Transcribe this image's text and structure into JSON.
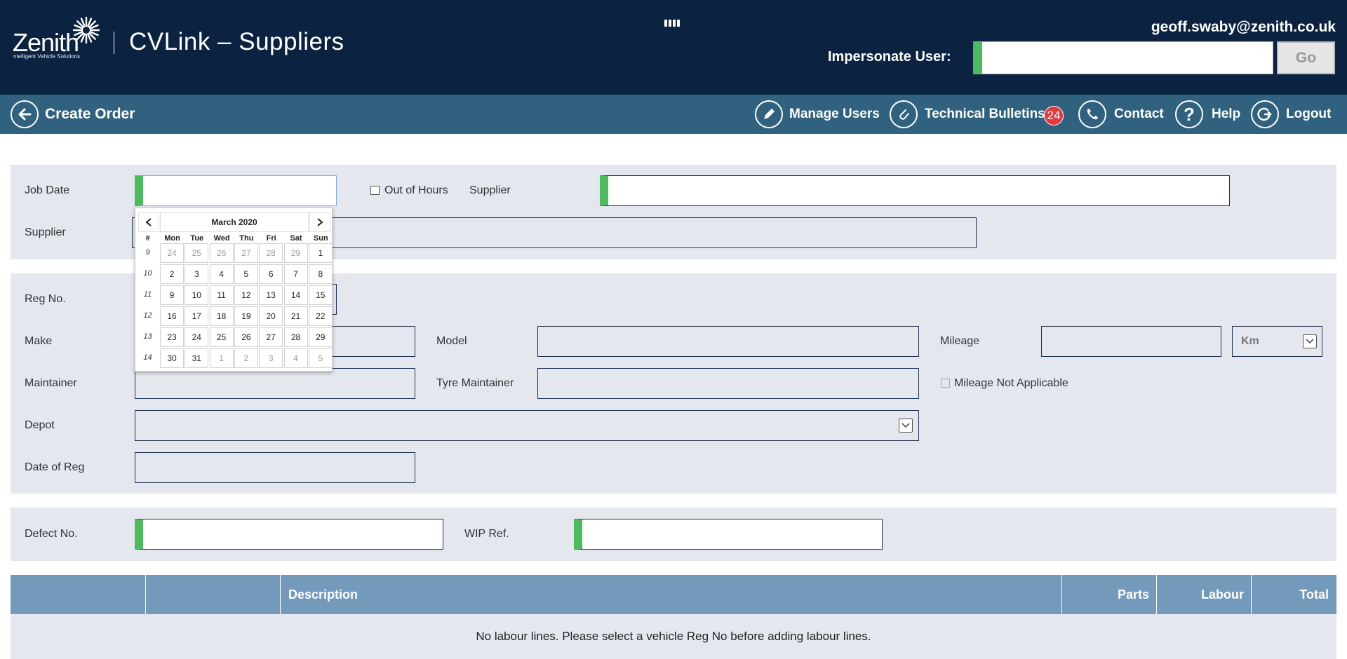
{
  "header": {
    "logo_word": "Zenith",
    "logo_tagline": "ntelligent Vehicle Solutions",
    "app_title": "CVLink – Suppliers",
    "user_email": "geoff.swaby@zenith.co.uk",
    "impersonate_label": "Impersonate User:",
    "impersonate_value": "",
    "go_label": "Go"
  },
  "nav": {
    "page_title": "Create Order",
    "items": [
      {
        "label": "Manage Users",
        "icon": "pencil-icon"
      },
      {
        "label": "Technical Bulletins",
        "icon": "paperclip-icon",
        "badge": "24"
      },
      {
        "label": "Contact",
        "icon": "phone-icon"
      },
      {
        "label": "Help",
        "icon": "question-icon"
      },
      {
        "label": "Logout",
        "icon": "logout-icon"
      }
    ]
  },
  "form": {
    "job_date_label": "Job Date",
    "out_of_hours_label": "Out of Hours",
    "supplier_label": "Supplier",
    "supplier_label_2": "Supplier",
    "reg_no_label": "Reg No.",
    "make_label": "Make",
    "model_label": "Model",
    "mileage_label": "Mileage",
    "mileage_unit": "Km",
    "maintainer_label": "Maintainer",
    "tyre_maintainer_label": "Tyre Maintainer",
    "mileage_na_label": "Mileage Not Applicable",
    "depot_label": "Depot",
    "date_of_reg_label": "Date of Reg",
    "defect_no_label": "Defect No.",
    "wip_ref_label": "WIP Ref."
  },
  "calendar": {
    "month_label": "March 2020",
    "week_header": "#",
    "day_headers": [
      "Mon",
      "Tue",
      "Wed",
      "Thu",
      "Fri",
      "Sat",
      "Sun"
    ],
    "weeks": [
      {
        "wk": "9",
        "days": [
          "24",
          "25",
          "26",
          "27",
          "28",
          "29",
          "1"
        ],
        "out": [
          true,
          true,
          true,
          true,
          true,
          true,
          false
        ]
      },
      {
        "wk": "10",
        "days": [
          "2",
          "3",
          "4",
          "5",
          "6",
          "7",
          "8"
        ],
        "out": [
          false,
          false,
          false,
          false,
          false,
          false,
          false
        ]
      },
      {
        "wk": "11",
        "days": [
          "9",
          "10",
          "11",
          "12",
          "13",
          "14",
          "15"
        ],
        "out": [
          false,
          false,
          false,
          false,
          false,
          false,
          false
        ]
      },
      {
        "wk": "12",
        "days": [
          "16",
          "17",
          "18",
          "19",
          "20",
          "21",
          "22"
        ],
        "out": [
          false,
          false,
          false,
          false,
          false,
          false,
          false
        ]
      },
      {
        "wk": "13",
        "days": [
          "23",
          "24",
          "25",
          "26",
          "27",
          "28",
          "29"
        ],
        "out": [
          false,
          false,
          false,
          false,
          false,
          false,
          false
        ]
      },
      {
        "wk": "14",
        "days": [
          "30",
          "31",
          "1",
          "2",
          "3",
          "4",
          "5"
        ],
        "out": [
          false,
          false,
          true,
          true,
          true,
          true,
          true
        ]
      }
    ]
  },
  "grid": {
    "columns": [
      "",
      "",
      "Description",
      "Parts",
      "Labour",
      "Total"
    ],
    "empty_message": "No labour lines. Please select a vehicle Reg No before adding labour lines."
  },
  "colors": {
    "header_bg": "#0b2240",
    "nav_bg": "#30627f",
    "panel_bg": "#e4e7ee",
    "required_marker": "#4cbb5d",
    "grid_header_bg": "#7399bb",
    "badge_red": "#e8373f"
  }
}
